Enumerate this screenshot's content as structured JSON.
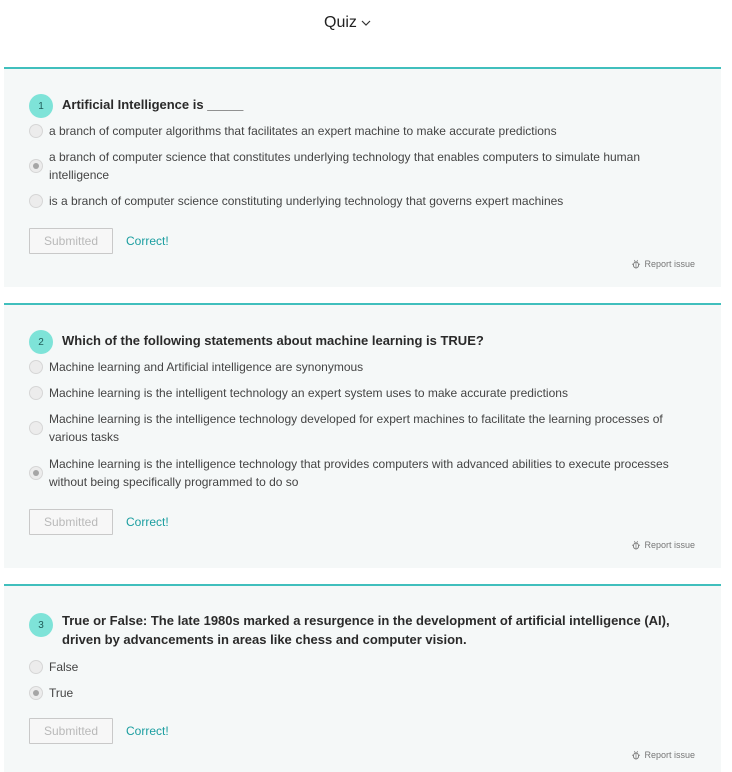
{
  "header": {
    "title": "Quiz"
  },
  "questions": [
    {
      "number": "1",
      "text": "Artificial Intelligence is _____",
      "options": [
        "a branch of computer algorithms that facilitates an expert machine to make accurate predictions",
        "a branch of computer science that constitutes underlying technology that enables computers to simulate human intelligence",
        "is a branch of computer science constituting underlying technology that governs expert machines"
      ],
      "selected_index": 1,
      "submitted_label": "Submitted",
      "result": "Correct!",
      "report_label": "Report issue"
    },
    {
      "number": "2",
      "text": "Which of the following statements about machine learning is TRUE?",
      "options": [
        "Machine learning and Artificial intelligence are synonymous",
        "Machine learning is the intelligent technology an expert system uses to make accurate predictions",
        "Machine learning is the intelligence technology developed for expert machines to facilitate the learning processes of various tasks",
        "Machine learning is the intelligence technology that provides computers with advanced abilities to execute processes without being specifically programmed to do so"
      ],
      "selected_index": 3,
      "submitted_label": "Submitted",
      "result": "Correct!",
      "report_label": "Report issue"
    },
    {
      "number": "3",
      "text": "True or False: The late 1980s marked a resurgence in the development of artificial intelligence (AI), driven by advancements in areas like chess and computer vision.",
      "options": [
        "False",
        "True"
      ],
      "selected_index": 1,
      "submitted_label": "Submitted",
      "result": "Correct!",
      "report_label": "Report issue"
    }
  ],
  "colors": {
    "accent": "#40bfbd",
    "number_badge": "#7ee3d8",
    "correct_text": "#1b9ea0",
    "card_background": "#f5f8f8"
  }
}
